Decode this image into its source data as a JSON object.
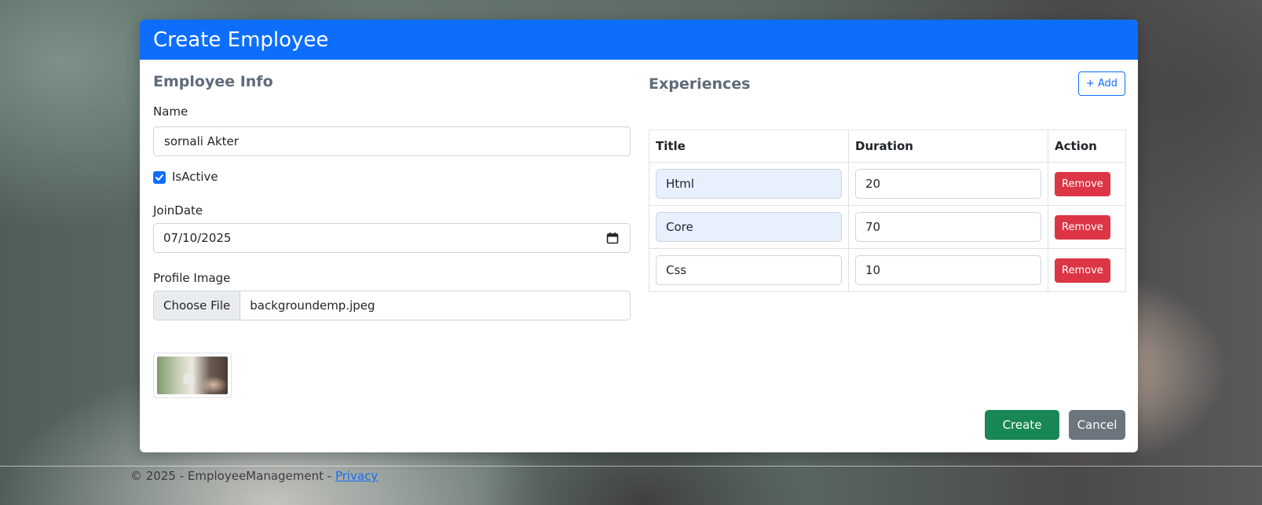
{
  "modal": {
    "title": "Create Employee"
  },
  "employee_info": {
    "heading": "Employee Info",
    "name_label": "Name",
    "name_value": "sornali Akter",
    "is_active_label": "IsActive",
    "is_active_checked": true,
    "join_date_label": "JoinDate",
    "join_date_value": "07/10/2025",
    "profile_image_label": "Profile Image",
    "choose_file_label": "Choose File",
    "file_name": "backgroundemp.jpeg"
  },
  "experiences": {
    "heading": "Experiences",
    "add_label": "+ Add",
    "columns": [
      "Title",
      "Duration",
      "Action"
    ],
    "rows": [
      {
        "title": "Html",
        "duration": "20",
        "action": "Remove"
      },
      {
        "title": "Core",
        "duration": "70",
        "action": "Remove"
      },
      {
        "title": "Css",
        "duration": "10",
        "action": "Remove"
      }
    ]
  },
  "actions": {
    "create_label": "Create",
    "cancel_label": "Cancel"
  },
  "footer": {
    "copyright": "© 2025 - EmployeeManagement - ",
    "privacy_link": "Privacy"
  },
  "colors": {
    "header": "#0d6efd",
    "create": "#198754",
    "cancel": "#6c757d",
    "remove": "#dc3545"
  },
  "icons": {
    "checkbox": "check-icon",
    "date": "calendar-icon"
  }
}
